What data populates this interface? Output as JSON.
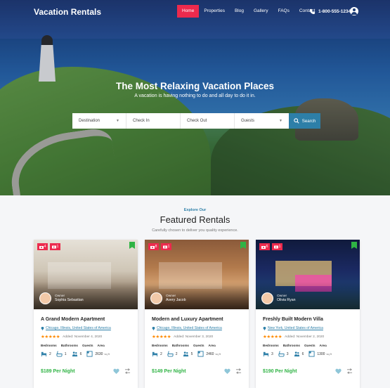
{
  "brand": "Vacation Rentals",
  "nav": {
    "items": [
      "Home",
      "Properties",
      "Blog",
      "Gallery",
      "FAQs",
      "Contact"
    ],
    "active": "Home",
    "phone": "1-800-555-1234"
  },
  "hero": {
    "title": "The Most Relaxing Vacation Places",
    "subtitle": "A vacation is having nothing to do and all day to do it in."
  },
  "search": {
    "destination": "Destination",
    "check_in": "Check In",
    "check_out": "Check Out",
    "guests": "Guests",
    "button": "Search"
  },
  "section": {
    "eyebrow": "Explore Our",
    "title": "Featured Rentals",
    "subtitle": "Carefully chosen to deliver you quality experience."
  },
  "labels": {
    "owner": "Owner",
    "added": "Added:",
    "bedrooms": "Bedrooms",
    "bathrooms": "Bathrooms",
    "guests": "Guests",
    "area": "Area",
    "sqft": "sq ft"
  },
  "cards": [
    {
      "photos": "4",
      "videos": "1",
      "owner": "Sophia Sebastian",
      "title": "A Grand Modern Apartment",
      "location": "Chicago, Illinois, United States of America",
      "stars": "★★★★★",
      "added": "November 4, 2020",
      "bedrooms": "2",
      "bathrooms": "1",
      "guests": "6",
      "area": "2630",
      "price": "$189 Per Night"
    },
    {
      "photos": "8",
      "videos": "1",
      "owner": "Avery Jacob",
      "title": "Modern and Luxury Apartment",
      "location": "Chicago, Illinois, United States of America",
      "stars": "★★★★★",
      "added": "November 3, 2020",
      "bedrooms": "2",
      "bathrooms": "2",
      "guests": "5",
      "area": "2460",
      "price": "$149 Per Night"
    },
    {
      "photos": "6",
      "videos": "1",
      "owner": "Olivia Ryan",
      "title": "Freshly Built Modern Villa",
      "location": "New York, United States of America",
      "stars": "★★★★★",
      "added": "November 2, 2020",
      "bedrooms": "3",
      "bathrooms": "3",
      "guests": "6",
      "area": "1300",
      "price": "$190 Per Night"
    }
  ],
  "colors": {
    "accent_red": "#ec2a4d",
    "accent_blue": "#2d7fa8",
    "price_green": "#2fb344",
    "star_orange": "#ff8a00"
  }
}
